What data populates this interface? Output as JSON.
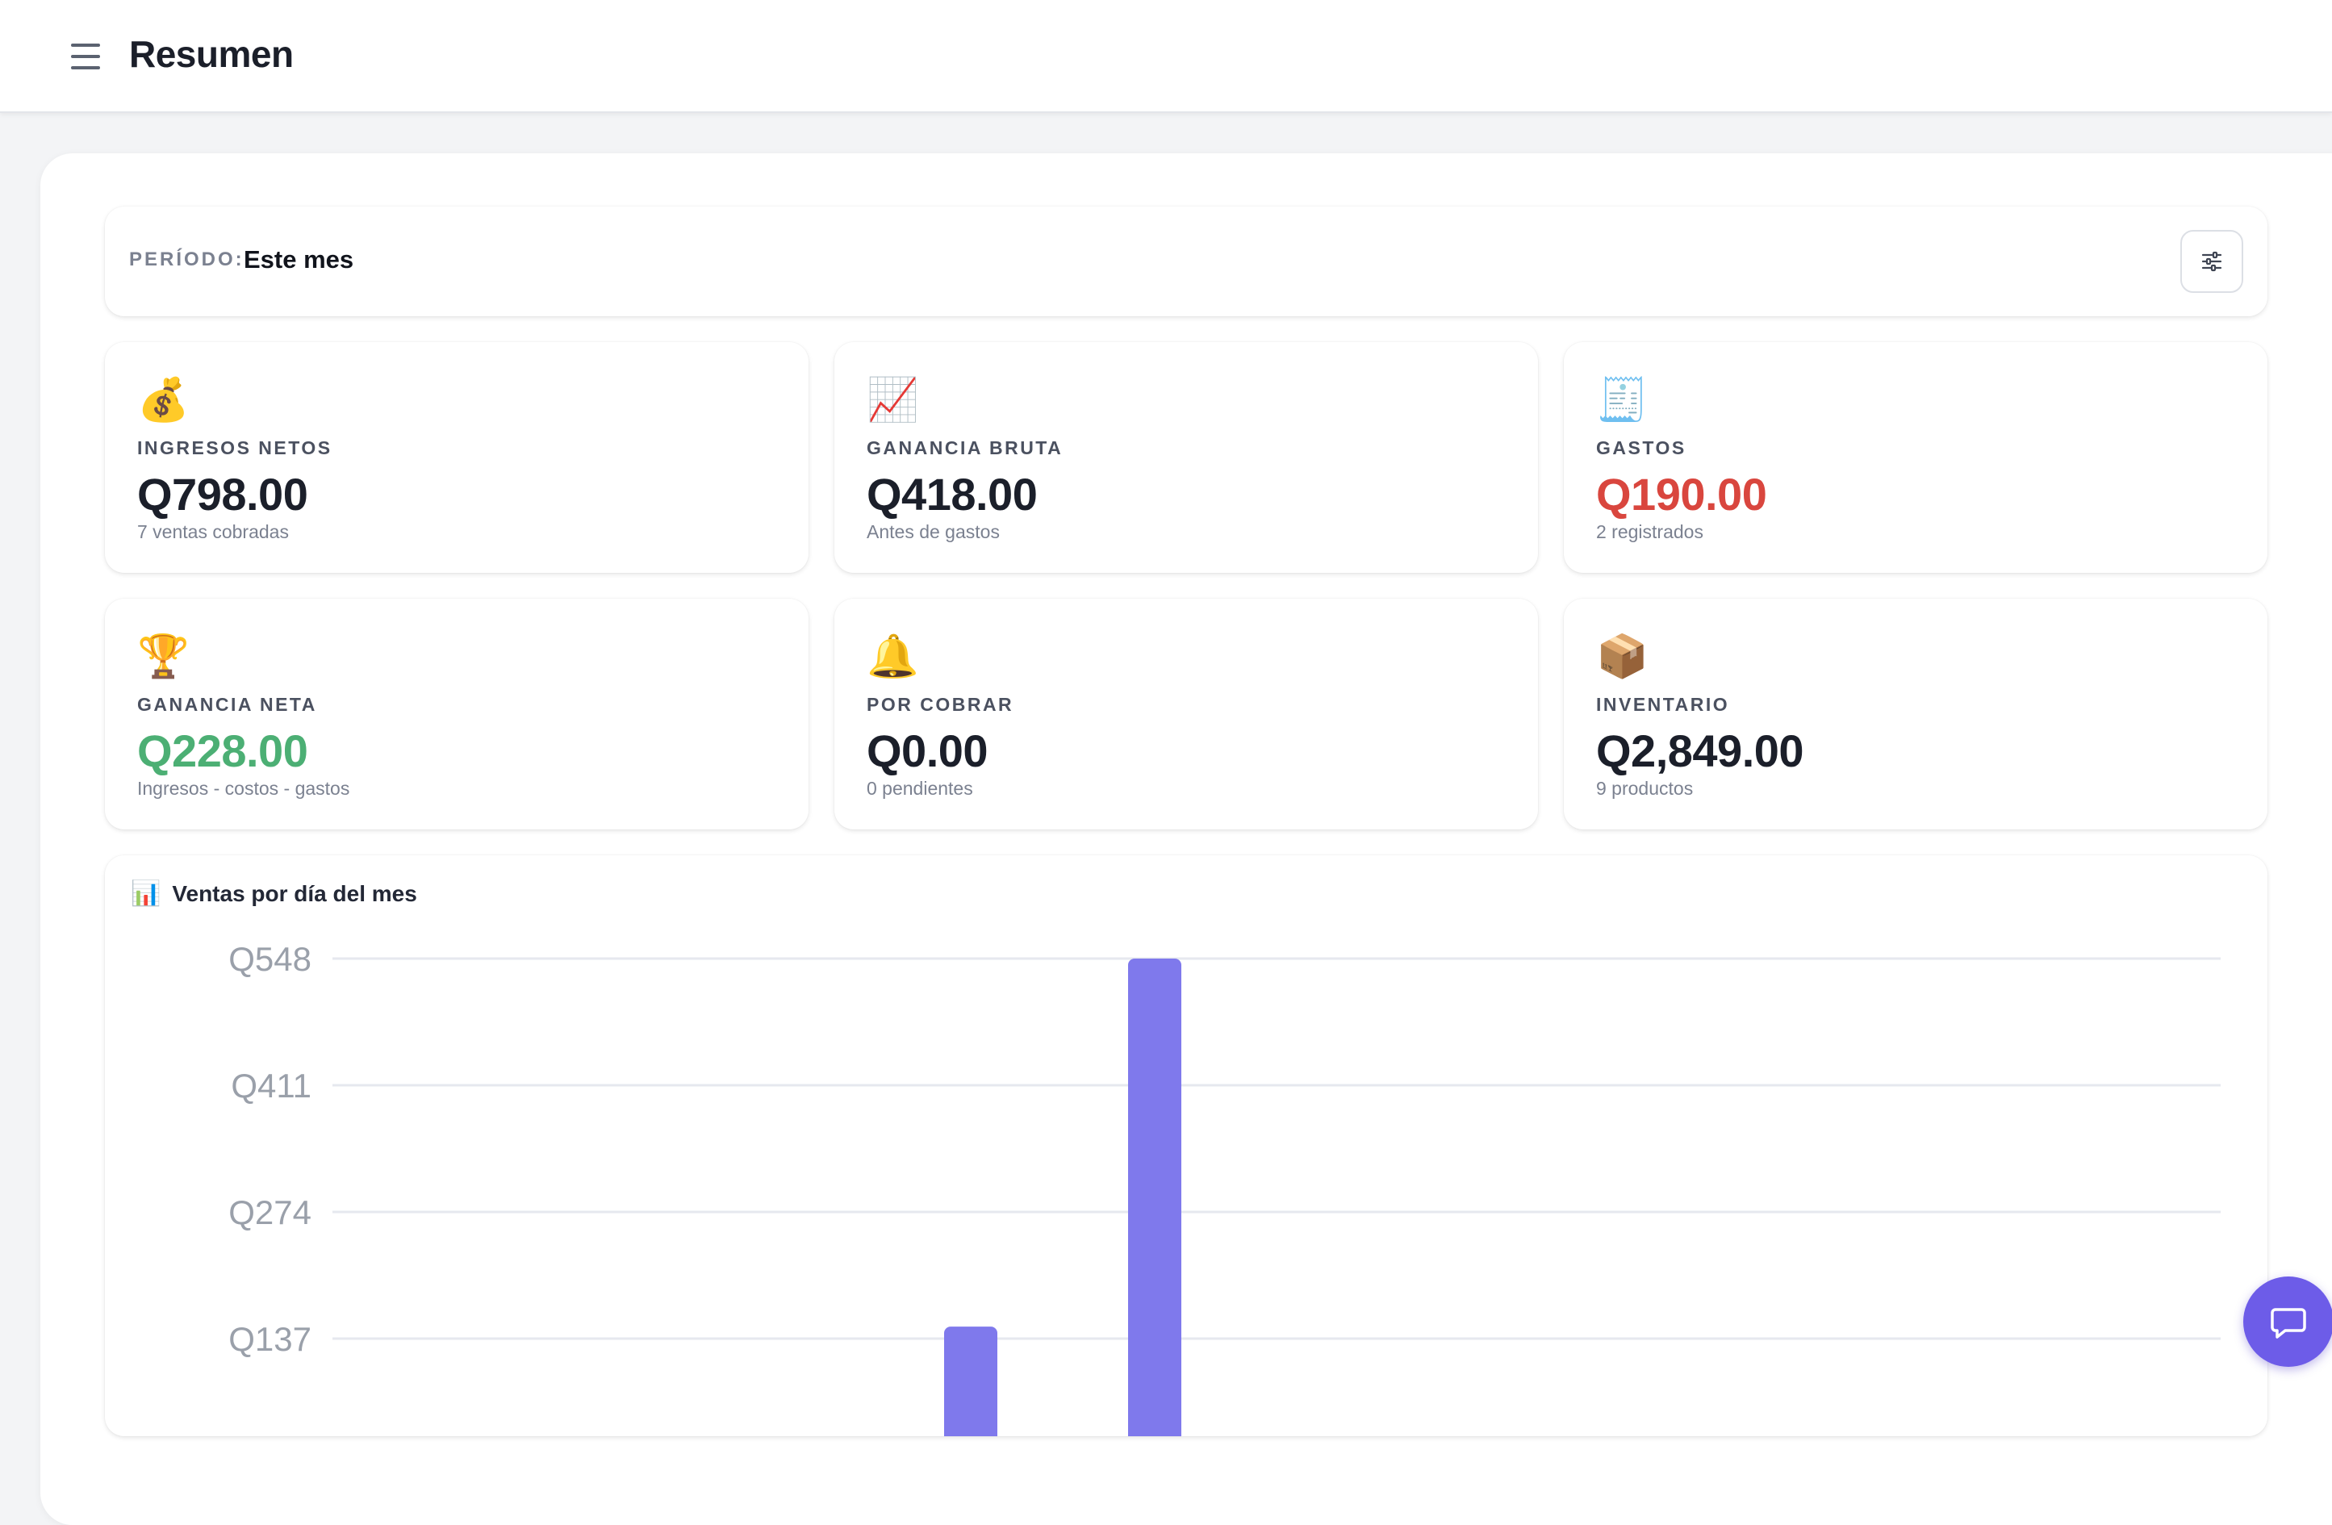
{
  "header": {
    "title": "Resumen"
  },
  "period": {
    "label": "PERÍODO:",
    "value": "Este mes"
  },
  "cards": [
    {
      "icon": "money-bag-icon",
      "emoji": "💰",
      "label": "INGRESOS NETOS",
      "value": "Q798.00",
      "sub": "7 ventas cobradas",
      "color": "#1b1f2a"
    },
    {
      "icon": "chart-up-icon",
      "emoji": "📈",
      "label": "GANANCIA BRUTA",
      "value": "Q418.00",
      "sub": "Antes de gastos",
      "color": "#1b1f2a"
    },
    {
      "icon": "receipt-icon",
      "emoji": "🧾",
      "label": "GASTOS",
      "value": "Q190.00",
      "sub": "2 registrados",
      "color": "#d9463e"
    },
    {
      "icon": "trophy-icon",
      "emoji": "🏆",
      "label": "GANANCIA NETA",
      "value": "Q228.00",
      "sub": "Ingresos - costos - gastos",
      "color": "#4caf74"
    },
    {
      "icon": "bell-icon",
      "emoji": "🔔",
      "label": "POR COBRAR",
      "value": "Q0.00",
      "sub": "0 pendientes",
      "color": "#1b1f2a"
    },
    {
      "icon": "package-icon",
      "emoji": "📦",
      "label": "INVENTARIO",
      "value": "Q2,849.00",
      "sub": "9 productos",
      "color": "#1b1f2a"
    }
  ],
  "chart": {
    "title_emoji": "📊",
    "title": "Ventas por día del mes"
  },
  "chart_data": {
    "type": "bar",
    "title": "Ventas por día del mes",
    "xlabel": "",
    "ylabel": "",
    "y_ticks": [
      "Q548",
      "Q411",
      "Q274",
      "Q137"
    ],
    "y_tick_values": [
      548,
      411,
      274,
      137
    ],
    "ylim": [
      0,
      548
    ],
    "grid": true,
    "bar_color": "#7f79ec",
    "bars": [
      {
        "value": 150
      },
      {
        "value": 548
      }
    ]
  },
  "colors": {
    "accent": "#6d5ce8",
    "bar": "#7f79ec",
    "negative": "#d9463e",
    "positive": "#4caf74"
  }
}
